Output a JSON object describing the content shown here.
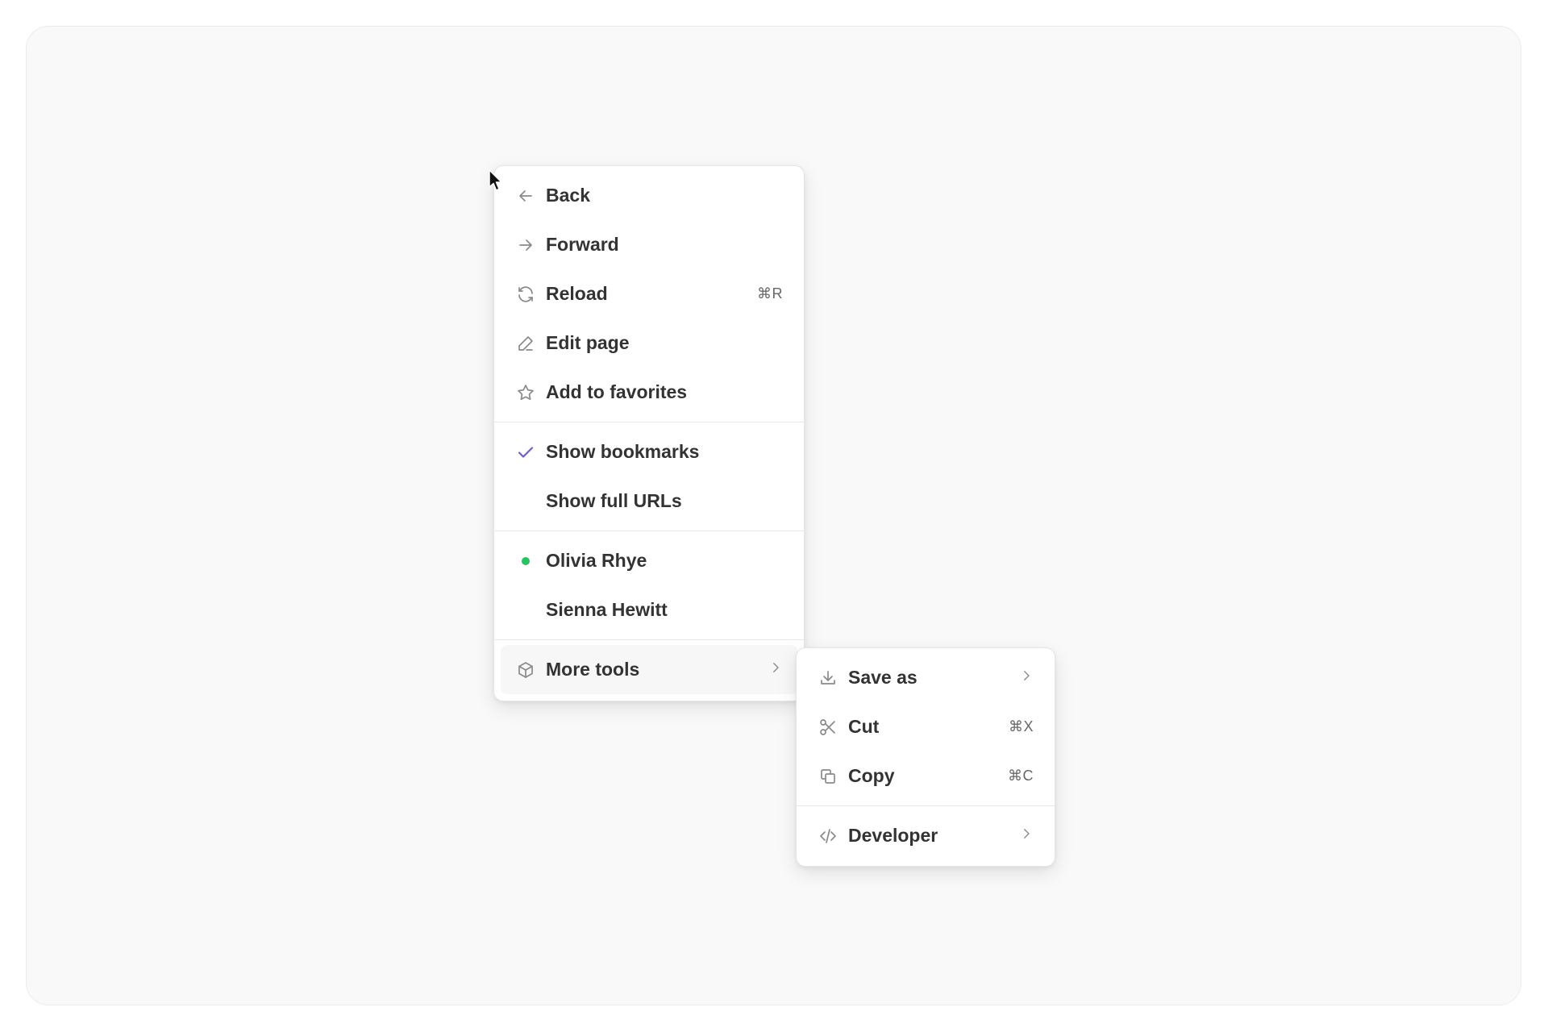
{
  "main_menu": {
    "items": [
      {
        "label": "Back",
        "icon": "arrow-left-icon",
        "shortcut": ""
      },
      {
        "label": "Forward",
        "icon": "arrow-right-icon",
        "shortcut": ""
      },
      {
        "label": "Reload",
        "icon": "refresh-icon",
        "shortcut": "⌘R"
      },
      {
        "label": "Edit page",
        "icon": "pencil-icon",
        "shortcut": ""
      },
      {
        "label": "Add to favorites",
        "icon": "star-icon",
        "shortcut": ""
      }
    ],
    "toggles": [
      {
        "label": "Show bookmarks",
        "checked": true
      },
      {
        "label": "Show full URLs",
        "checked": false
      }
    ],
    "users": [
      {
        "label": "Olivia Rhye",
        "selected": true
      },
      {
        "label": "Sienna Hewitt",
        "selected": false
      }
    ],
    "more_tools": {
      "label": "More tools",
      "icon": "box-icon"
    }
  },
  "sub_menu": {
    "items": [
      {
        "label": "Save as",
        "icon": "download-icon",
        "shortcut": ""
      },
      {
        "label": "Cut",
        "icon": "scissors-icon",
        "shortcut": "⌘X"
      },
      {
        "label": "Copy",
        "icon": "copy-icon",
        "shortcut": "⌘C"
      }
    ],
    "developer": {
      "label": "Developer",
      "icon": "code-icon"
    }
  },
  "colors": {
    "check": "#6c5dd3",
    "online_dot": "#22c55e",
    "text": "#333333",
    "icon": "#8a8a8a"
  }
}
